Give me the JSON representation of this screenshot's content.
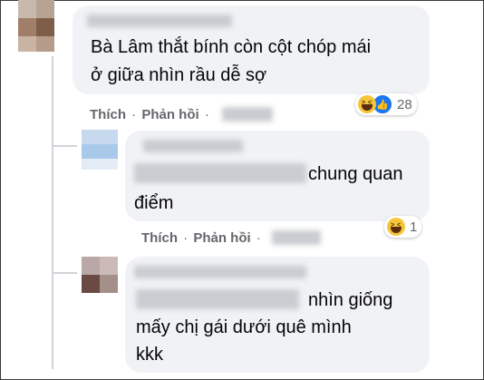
{
  "comments": [
    {
      "text_lines": [
        "Bà Lâm thắt bính còn cột chóp mái",
        "ở giữa nhìn rầu dễ sợ"
      ],
      "actions": {
        "like": "Thích",
        "reply": "Phản hồi"
      },
      "reactions": {
        "icons": [
          "haha-icon",
          "like-icon"
        ],
        "count": "28"
      }
    },
    {
      "text_lines": [
        "chung quan",
        "điểm"
      ],
      "actions": {
        "like": "Thích",
        "reply": "Phản hồi"
      },
      "reactions": {
        "icons": [
          "haha-icon"
        ],
        "count": "1"
      }
    },
    {
      "text_lines": [
        "nhìn giống",
        "mấy chị gái dưới quê mình",
        "kkk"
      ]
    }
  ],
  "separator": "·",
  "colors": {
    "bubble": "#f0f2f5",
    "action_text": "#65676b",
    "like_blue": "#1877f2",
    "haha_yellow": "#f7c53a"
  }
}
